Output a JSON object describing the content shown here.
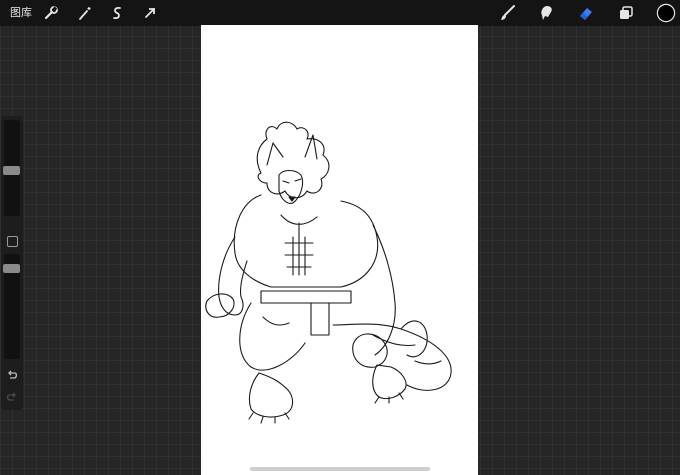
{
  "toolbar": {
    "gallery_label": "图库",
    "left_icons": [
      "wrench-icon",
      "magic-wand-icon",
      "selection-icon",
      "transform-arrow-icon"
    ],
    "right_icons": [
      "brush-icon",
      "smudge-icon",
      "eraser-icon",
      "layers-icon",
      "color-swatch-icon"
    ],
    "active_tool": "eraser",
    "accent_color": "#3d7bf5",
    "current_color": "#000000"
  },
  "sidebar": {
    "brush_size_level": 0.5,
    "opacity_level": 0.9,
    "undo_icon": "undo-arrow-icon",
    "redo_icon": "redo-arrow-icon"
  },
  "canvas": {
    "background": "#ffffff",
    "artwork": "line-art-werewolf-crouching"
  }
}
